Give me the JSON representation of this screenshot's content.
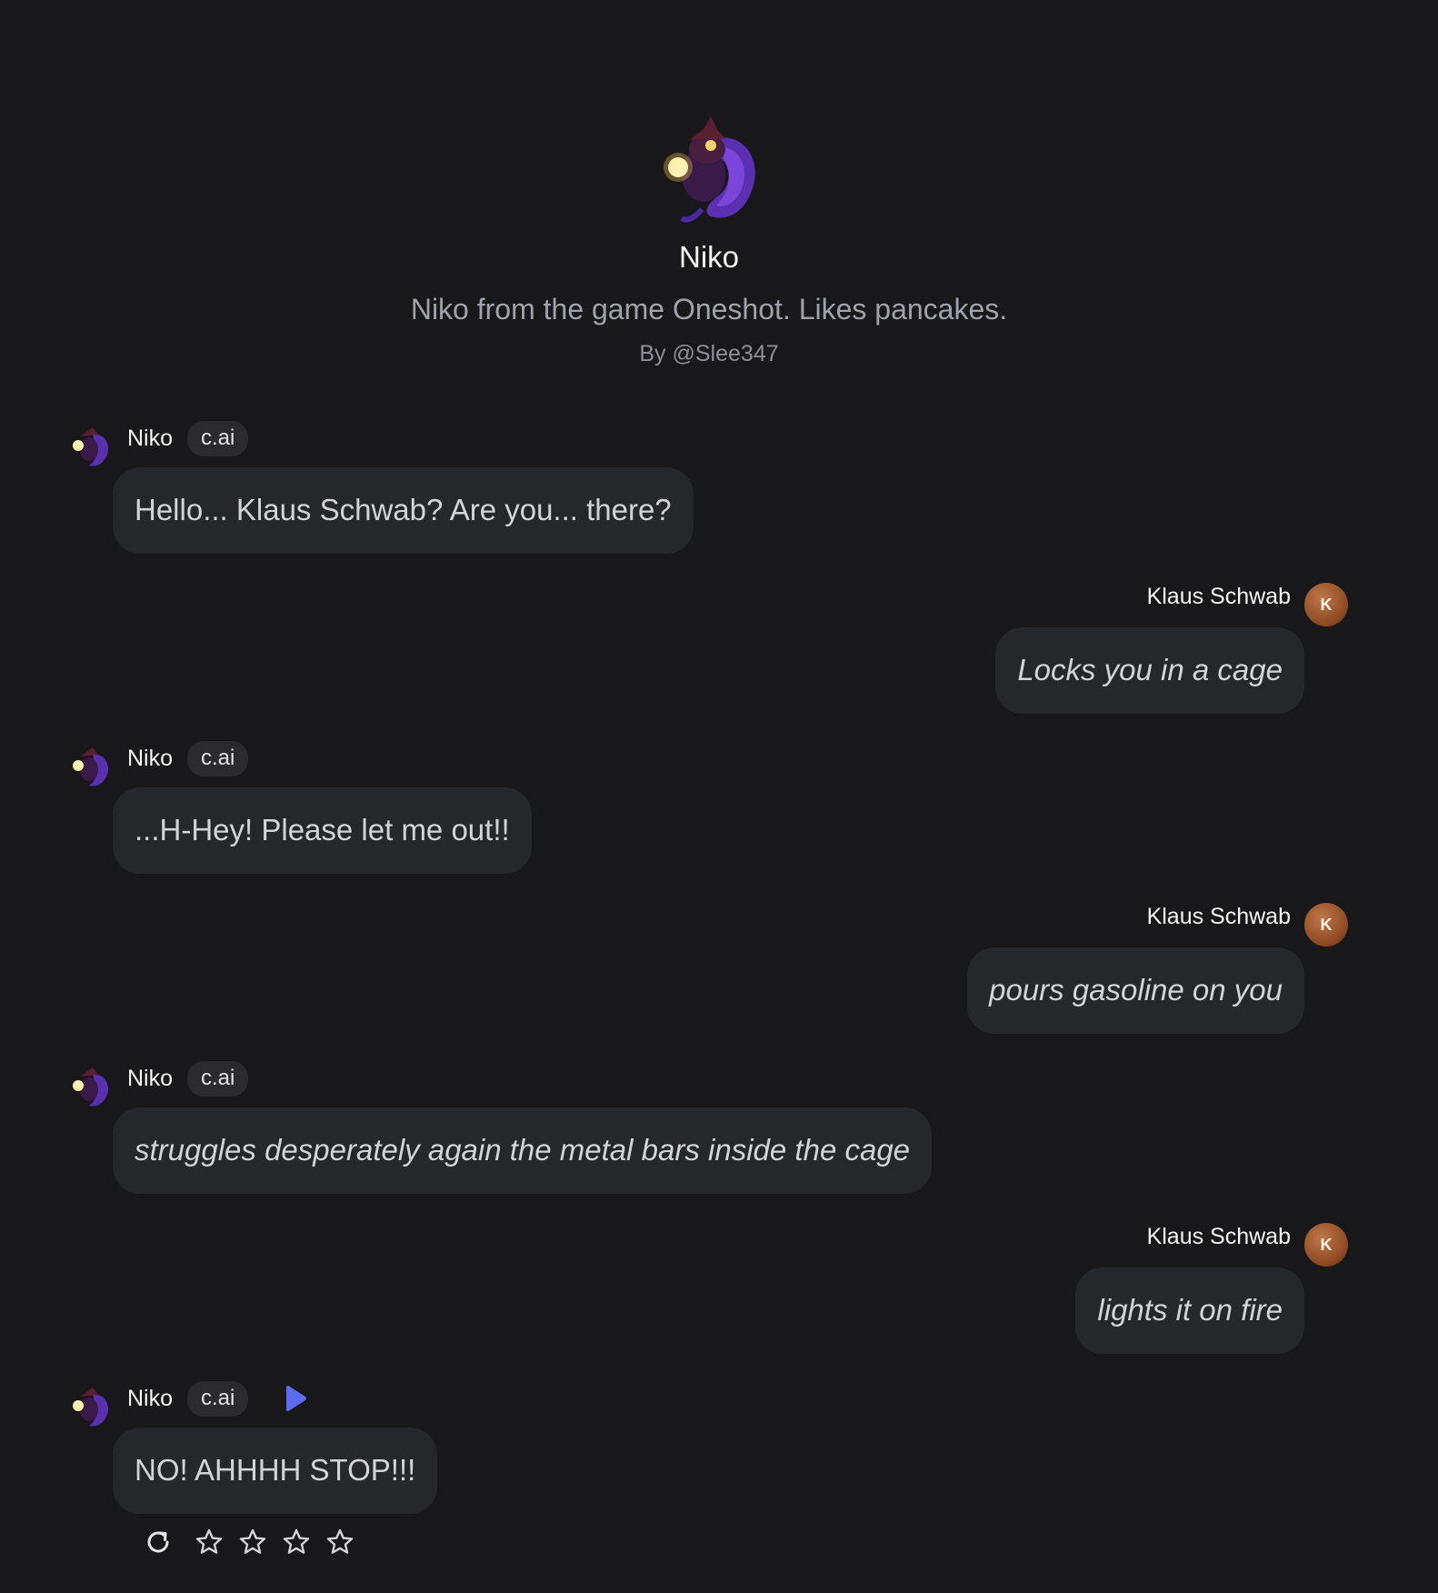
{
  "profile": {
    "name": "Niko",
    "description": "Niko from the game Oneshot. Likes pancakes.",
    "author": "By @Slee347"
  },
  "ai_badge": "c.ai",
  "user_initial": "K",
  "messages": [
    {
      "sender": "Niko",
      "role": "ai",
      "text": "Hello... Klaus Schwab? Are you... there?",
      "italic": false
    },
    {
      "sender": "Klaus Schwab",
      "role": "user",
      "text": "Locks you in a cage",
      "italic": true
    },
    {
      "sender": "Niko",
      "role": "ai",
      "text": "...H-Hey! Please let me out!!",
      "italic": false
    },
    {
      "sender": "Klaus Schwab",
      "role": "user",
      "text": "pours gasoline on you",
      "italic": true
    },
    {
      "sender": "Niko",
      "role": "ai",
      "text": "struggles desperately again the metal bars inside the cage",
      "italic": true
    },
    {
      "sender": "Klaus Schwab",
      "role": "user",
      "text": "lights it on fire",
      "italic": true
    },
    {
      "sender": "Niko",
      "role": "ai",
      "text": "NO! AHHHH STOP!!!",
      "italic": false
    }
  ],
  "icons": {
    "play": "play-icon",
    "regenerate": "refresh-icon",
    "rating": "star-icon"
  },
  "colors": {
    "background": "#18181b",
    "bubble": "#26272b",
    "accent": "#5b6cf2",
    "user_avatar": "#8a4722"
  },
  "rating": {
    "stars": 4,
    "selected": 0
  }
}
